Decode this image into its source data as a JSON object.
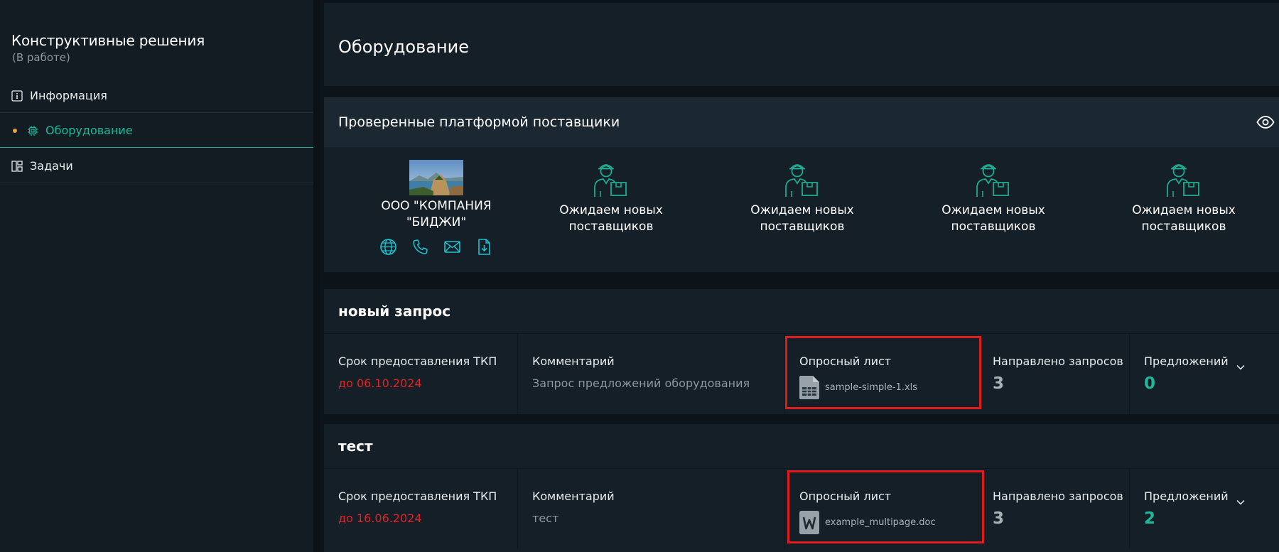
{
  "sidebar": {
    "title": "Конструктивные решения",
    "status": "(В работе)",
    "items": [
      {
        "label": "Информация",
        "icon": "info-icon"
      },
      {
        "label": "Оборудование",
        "icon": "chip-icon",
        "active": true
      },
      {
        "label": "Задачи",
        "icon": "layout-icon"
      }
    ]
  },
  "header": {
    "title": "Оборудование"
  },
  "suppliers": {
    "title": "Проверенные платформой поставщики",
    "company": {
      "name_line1": "ООО \"КОМПАНИЯ",
      "name_line2": "\"БИДЖИ\""
    },
    "pending_label_line1": "Ожидаем новых",
    "pending_label_line2": "поставщиков"
  },
  "requests": [
    {
      "title": "новый запрос",
      "deadline_label": "Срок предоставления ТКП",
      "deadline_value": "до 06.10.2024",
      "comment_label": "Комментарий",
      "comment_value": "Запрос предложений оборудования",
      "survey_label": "Опросный лист",
      "survey_file": "sample-simple-1.xls",
      "survey_file_type": "xls",
      "sent_label": "Направлено запросов",
      "sent_value": "3",
      "offers_label": "Предложений",
      "offers_value": "0"
    },
    {
      "title": "тест",
      "deadline_label": "Срок предоставления ТКП",
      "deadline_value": "до 16.06.2024",
      "comment_label": "Комментарий",
      "comment_value": "тест",
      "survey_label": "Опросный лист",
      "survey_file": "example_multipage.doc",
      "survey_file_type": "doc",
      "sent_label": "Направлено запросов",
      "sent_value": "3",
      "offers_label": "Предложений",
      "offers_value": "2"
    }
  ],
  "colors": {
    "accent": "#20b79b",
    "danger": "#e02424",
    "highlight": "#e01b1b",
    "active_dot": "#e8a33d"
  }
}
